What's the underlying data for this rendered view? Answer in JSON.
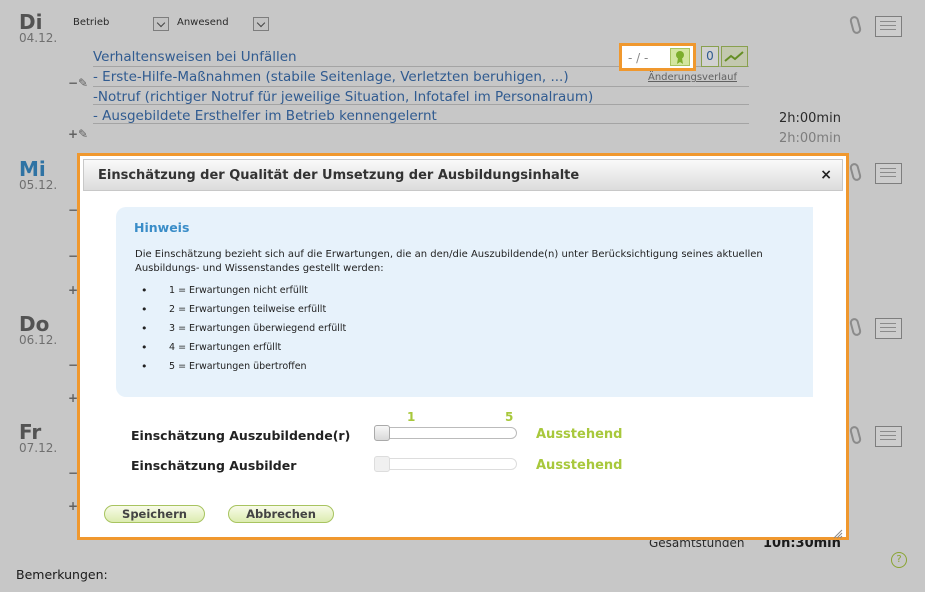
{
  "header": {
    "betrieb_label": "Betrieb",
    "anwesend_label": "Anwesend"
  },
  "days": [
    {
      "name": "Di",
      "date": "04.12."
    },
    {
      "name": "Mi",
      "date": "05.12."
    },
    {
      "name": "Do",
      "date": "06.12."
    },
    {
      "name": "Fr",
      "date": "07.12."
    }
  ],
  "entries": {
    "line1": "Verhaltensweisen bei Unfällen",
    "line2": "- Erste-Hilfe-Maßnahmen (stabile Seitenlage, Verletzten beruhigen, ...)",
    "line3": "-Notruf (richtiger Notruf für jeweilige Situation, Infotafel im Personalraum)",
    "line4": "- Ausgebildete Ersthelfer im Betrieb kennengelernt"
  },
  "rating_box": {
    "value": "- / -",
    "count": "0"
  },
  "aenderungsverlauf": "Änderungsverlauf",
  "times": {
    "t1": "2h:00min",
    "t2": "2h:00min"
  },
  "gesamt": {
    "label": "Gesamtstunden",
    "value": "10h:30min"
  },
  "bemerkungen": "Bemerkungen:",
  "dialog": {
    "title": "Einschätzung der Qualität der Umsetzung der Ausbildungsinhalte",
    "close": "×",
    "hint_title": "Hinweis",
    "hint_text": "Die Einschätzung bezieht sich auf die Erwartungen, die an den/die Auszubildende(n) unter Berücksichtigung seines aktuellen Ausbildungs- und Wissenstandes gestellt werden:",
    "hint_items": [
      "1 = Erwartungen nicht erfüllt",
      "2 = Erwartungen teilweise erfüllt",
      "3 = Erwartungen überwiegend erfüllt",
      "4 = Erwartungen erfüllt",
      "5 = Erwartungen übertroffen"
    ],
    "scale_min": "1",
    "scale_max": "5",
    "rating_azubi_label": "Einschätzung Auszubildende(r)",
    "rating_ausbilder_label": "Einschätzung Ausbilder",
    "status_azubi": "Ausstehend",
    "status_ausbilder": "Ausstehend",
    "save_label": "Speichern",
    "cancel_label": "Abbrechen"
  },
  "colors": {
    "accent_orange": "#f0982e",
    "status_green": "#a8c83c",
    "link_blue": "#3b6fb0"
  }
}
